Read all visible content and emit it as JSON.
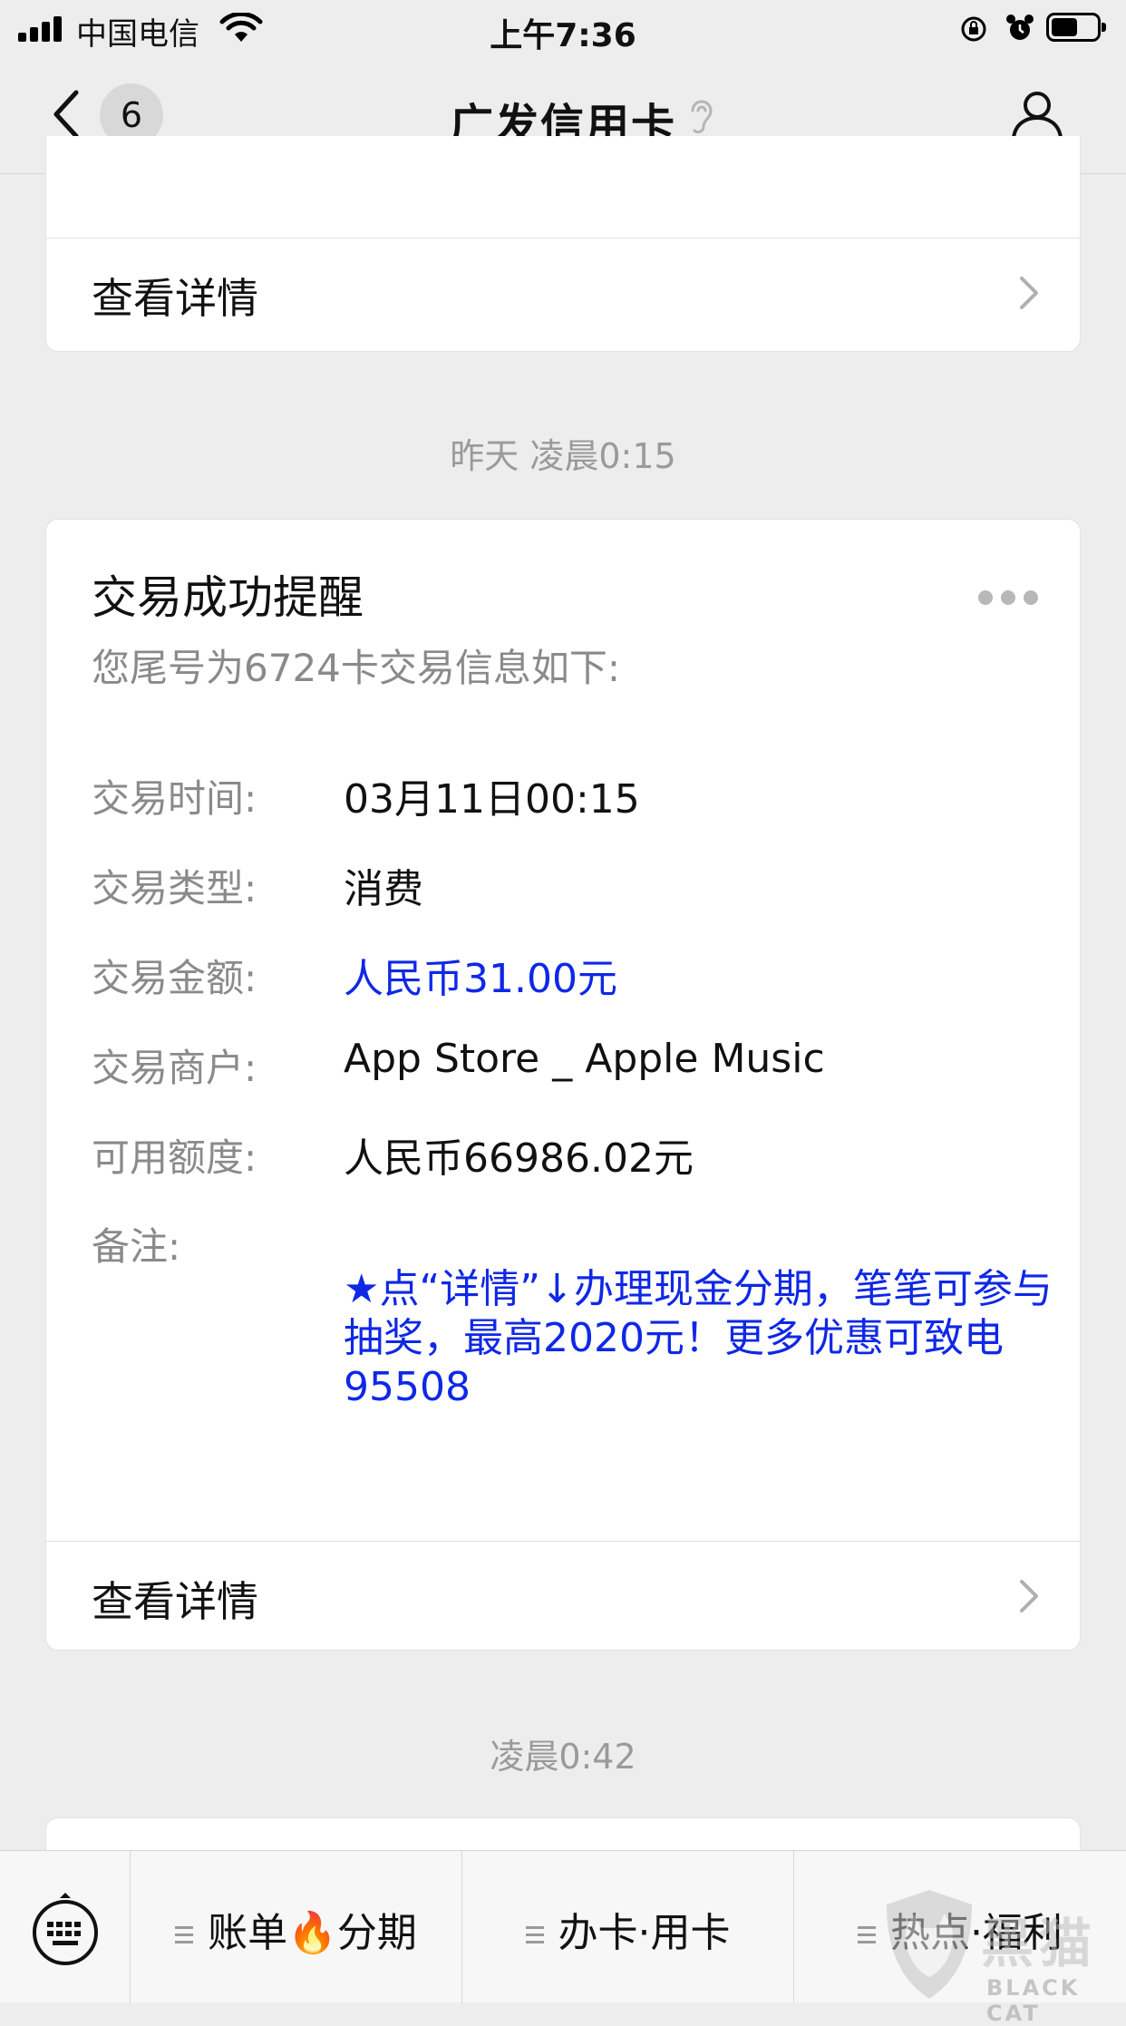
{
  "status_bar": {
    "carrier": "中国电信",
    "time": "上午7:36",
    "battery_level": 0.6
  },
  "nav": {
    "unread_count": "6",
    "title": "广发信用卡"
  },
  "top_card": {
    "details_label": "查看详情"
  },
  "timestamp_1": "昨天 凌晨0:15",
  "message": {
    "title": "交易成功提醒",
    "subtitle": "您尾号为6724卡交易信息如下:",
    "fields": [
      {
        "label": "交易时间:",
        "value": "03月11日00:15"
      },
      {
        "label": "交易类型:",
        "value": "消费"
      },
      {
        "label": "交易金额:",
        "value": "人民币31.00元",
        "color": "#0f28e6"
      },
      {
        "label": "交易商户:",
        "value": "App Store _ Apple Music"
      },
      {
        "label": "可用额度:",
        "value": "人民币66986.02元"
      }
    ],
    "note_label": "备注:",
    "note": "★点“详情”↓办理现金分期，笔笔可参与抽奖，最高2020元！更多优惠可致电95508",
    "details_label": "查看详情"
  },
  "timestamp_2": "凌晨0:42",
  "bottom_menu": {
    "items": [
      {
        "label_before": "账单",
        "emoji": "🔥",
        "label_after": "分期"
      },
      {
        "label": "办卡·用卡"
      },
      {
        "label": "热点·福利"
      }
    ]
  },
  "watermark": {
    "cn": "黑猫",
    "en": "BLACK CAT"
  },
  "colors": {
    "accent_blue": "#0f28e6",
    "background": "#ededed"
  }
}
